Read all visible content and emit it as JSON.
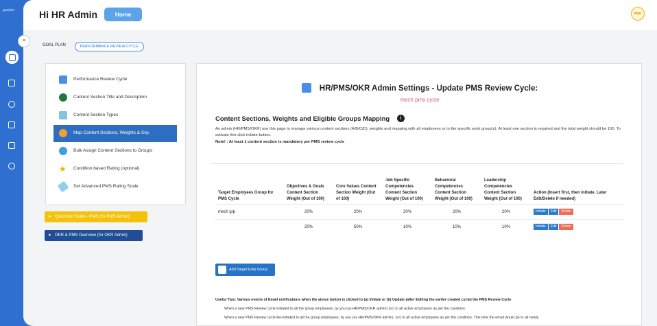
{
  "brand": "goalsiter",
  "header": {
    "greeting": "Hi HR Admin",
    "home_label": "Home",
    "avatar_text": "Nori"
  },
  "tabs": {
    "goal_plan": "GOAL PLAN",
    "review_cycle": "PERFORMANCE REVIEW CYCLE"
  },
  "menu": [
    {
      "label": "Performance Review Cycle",
      "icon": "calendar-icon",
      "color": "#4a8fe7"
    },
    {
      "label": "Content Section Title and Description",
      "icon": "dots-icon",
      "color": "#1e7a3c"
    },
    {
      "label": "Content Section Types",
      "icon": "badge-icon",
      "color": "#7fc4e0"
    },
    {
      "label": "Map Content Sections, Weights & Grp.",
      "icon": "people-icon",
      "color": "#f0a030"
    },
    {
      "label": "Bulk Assign Content Sections to Groups",
      "icon": "group-icon",
      "color": "#3aa0e0"
    },
    {
      "label": "Condition based Rating (optional)",
      "icon": "star-icon",
      "color": "#f4b400"
    },
    {
      "label": "Set Advanced PMS Rating Scale",
      "icon": "ruler-icon",
      "color": "#8fd0ef"
    }
  ],
  "quickstart": "Quickstart Guide - PMS (for PMS Admin)",
  "okr_overview": "OKR & PMS Overview (for OKR Admin)",
  "page": {
    "title": "HR/PMS/OKR Admin Settings - Update PMS Review Cycle:",
    "subtitle": "mech pms cycle",
    "section_heading": "Content Sections, Weights and Eligible Groups Mapping",
    "description": "As admin (HR/PMS/OKR) use this page to manage various content sections (A/B/C/D), weights and mapping with all employees or to the specific work group(s). At least one section is required and the total weight should be 100. To activate this click initiate button.",
    "note": "Note! : At least 1 content section is mandatory per PMS review cycle"
  },
  "table": {
    "headers": [
      "Target Employees Group for PMS Cycle",
      "Objectives & Goals Content Section Weight (Out of 100)",
      "Core Values Content Section Weight (Out of 100)",
      "Job Specific Competencies Content Section Weight (Out of 100)",
      "Behavioral Competencies Content Section Weight (Out of 100)",
      "Leadership Competencies Content Section Weight (Out of 100)",
      "Action (Insert first, then initiate. Later Edit/Delete if needed)"
    ],
    "rows": [
      {
        "group": "mech grp",
        "w1": "20%",
        "w2": "20%",
        "w3": "20%",
        "w4": "20%",
        "w5": "20%"
      },
      {
        "group": "",
        "w1": "20%",
        "w2": "50%",
        "w3": "10%",
        "w4": "10%",
        "w5": "10%"
      }
    ],
    "actions": {
      "initiate": "Initiate",
      "edit": "Edit",
      "delete": "Delete"
    }
  },
  "add_group": "Add Target Emp Group",
  "tips": {
    "heading": "Useful Tips:   Various events of Email notifications when the above button is clicked to (a) Initiate or (b) Update (after Editing the earlier created cycle)   the PMS Review Cycle",
    "tip1": "When a new PMS Review cycle  initiated to all  the group employees, by you (as HR/PMS/OKR admin)  (or) to all  active employees as per the condition.",
    "tip2": "When a new PMS Review cycle  Re-initiated to all  the group employees, by you (as HR/PMS/OKR admin). (or) to all  active employees as per the condition. This time the email would go to all newly"
  }
}
